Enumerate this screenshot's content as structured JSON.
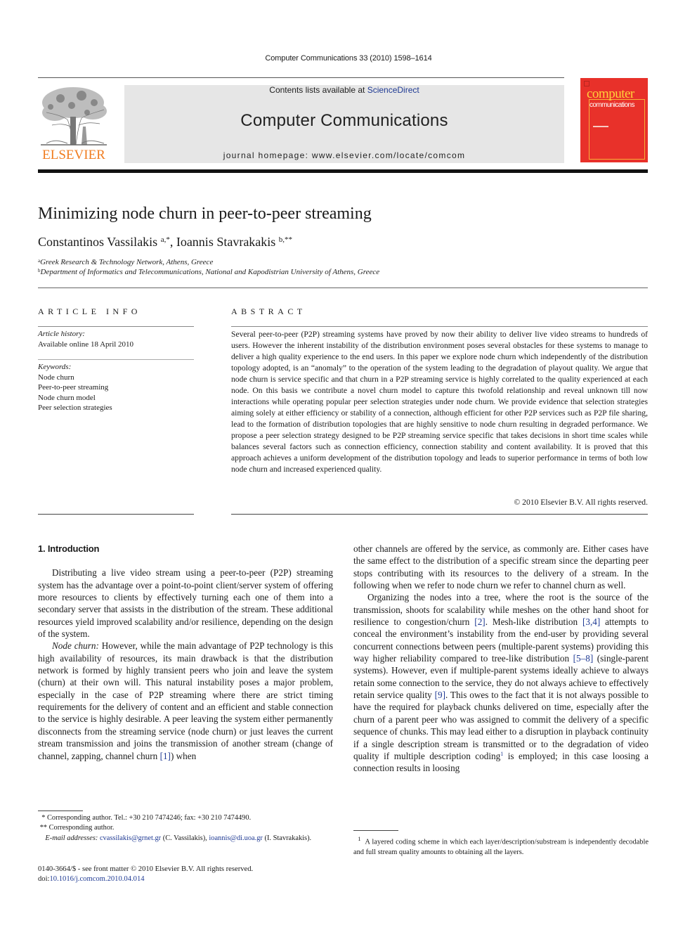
{
  "header": {
    "journal_reference": "Computer Communications 33 (2010) 1598–1614",
    "contents_prefix": "Contents lists available at ",
    "contents_link": "ScienceDirect",
    "journal_name": "Computer Communications",
    "homepage_line": "journal homepage: www.elsevier.com/locate/comcom",
    "publisher_logo_text": "ELSEVIER",
    "cover": {
      "title_line1": "computer",
      "title_line2": "communications",
      "background_color": "#e8312a",
      "title_color": "#ffd23a"
    },
    "logo_color": "#f07c1f"
  },
  "article": {
    "title": "Minimizing node churn in peer-to-peer streaming",
    "authors": [
      {
        "name": "Constantinos Vassilakis",
        "marks": "a,*"
      },
      {
        "name": "Ioannis Stavrakakis",
        "marks": "b,**"
      }
    ],
    "author_separator": ", ",
    "affiliations": [
      {
        "mark": "a",
        "text": "Greek Research & Technology Network, Athens, Greece"
      },
      {
        "mark": "b",
        "text": "Department of Informatics and Telecommunications, National and Kapodistrian University of Athens, Greece"
      }
    ]
  },
  "article_info": {
    "heading": "ARTICLE INFO",
    "history_label": "Article history:",
    "history_value": "Available online 18 April 2010",
    "keywords_label": "Keywords:",
    "keywords": [
      "Node churn",
      "Peer-to-peer streaming",
      "Node churn model",
      "Peer selection strategies"
    ]
  },
  "abstract": {
    "heading": "ABSTRACT",
    "text": "Several peer-to-peer (P2P) streaming systems have proved by now their ability to deliver live video streams to hundreds of users. However the inherent instability of the distribution environment poses several obstacles for these systems to manage to deliver a high quality experience to the end users. In this paper we explore node churn which independently of the distribution topology adopted, is an “anomaly” to the operation of the system leading to the degradation of playout quality. We argue that node churn is service specific and that churn in a P2P streaming service is highly correlated to the quality experienced at each node. On this basis we contribute a novel churn model to capture this twofold relationship and reveal unknown till now interactions while operating popular peer selection strategies under node churn. We provide evidence that selection strategies aiming solely at either efficiency or stability of a connection, although efficient for other P2P services such as P2P file sharing, lead to the formation of distribution topologies that are highly sensitive to node churn resulting in degraded performance. We propose a peer selection strategy designed to be P2P streaming service specific that takes decisions in short time scales while balances several factors such as connection efficiency, connection stability and content availability. It is proved that this approach achieves a uniform development of the distribution topology and leads to superior performance in terms of both low node churn and increased experienced quality.",
    "copyright": "© 2010 Elsevier B.V. All rights reserved."
  },
  "body": {
    "section_heading": "1. Introduction",
    "left_paragraphs": [
      {
        "runs": [
          {
            "t": "Distributing a live video stream using a peer-to-peer (P2P) streaming system has the advantage over a point-to-point client/server system of offering more resources to clients by effectively turning each one of them into a secondary server that assists in the distribution of the stream. These additional resources yield improved scalability and/or resilience, depending on the design of the system."
          }
        ]
      },
      {
        "runs": [
          {
            "t": "Node churn:",
            "style": "em"
          },
          {
            "t": " However, while the main advantage of P2P technology is this high availability of resources, its main drawback is that the distribution network is formed by highly transient peers who join and leave the system (churn) at their own will. This natural instability poses a major problem, especially in the case of P2P streaming where there are strict timing requirements for the delivery of content and an efficient and stable connection to the service is highly desirable. A peer leaving the system either permanently disconnects from the streaming service (node churn) or just leaves the current stream transmission and joins the transmission of another stream (change of channel, zapping, channel churn "
          },
          {
            "t": "[1]",
            "style": "link"
          },
          {
            "t": ") when"
          }
        ]
      }
    ],
    "right_paragraphs": [
      {
        "noindent": true,
        "runs": [
          {
            "t": "other channels are offered by the service, as commonly are. Either cases have the same effect to the distribution of a specific stream since the departing peer stops contributing with its resources to the delivery of a stream. In the following when we refer to node churn we refer to channel churn as well."
          }
        ]
      },
      {
        "runs": [
          {
            "t": "Organizing the nodes into a tree, where the root is the source of the transmission, shoots for scalability while meshes on the other hand shoot for resilience to congestion/churn "
          },
          {
            "t": "[2]",
            "style": "link"
          },
          {
            "t": ". Mesh-like distribution "
          },
          {
            "t": "[3,4]",
            "style": "link"
          },
          {
            "t": " attempts to conceal the environment’s instability from the end-user by providing several concurrent connections between peers (multiple-parent systems) providing this way higher reliability compared to tree-like distribution "
          },
          {
            "t": "[5–8]",
            "style": "link"
          },
          {
            "t": " (single-parent systems). However, even if multiple-parent systems ideally achieve to always retain some connection to the service, they do not always achieve to effectively retain service quality "
          },
          {
            "t": "[9]",
            "style": "link"
          },
          {
            "t": ". This owes to the fact that it is not always possible to have the required for playback chunks delivered on time, especially after the churn of a parent peer who was assigned to commit the delivery of a specific sequence of chunks. This may lead either to a disruption in playback continuity if a single description stream is transmitted or to the degradation of video quality if multiple description coding"
          },
          {
            "t": "1",
            "style": "sup-link"
          },
          {
            "t": " is employed; in this case loosing a connection results in loosing"
          }
        ]
      }
    ]
  },
  "footnotes": {
    "left": [
      {
        "runs": [
          {
            "t": "  * Corresponding author. Tel.: +30 210 7474246; fax: +30 210 7474490."
          }
        ]
      },
      {
        "runs": [
          {
            "t": " ** Corresponding author."
          }
        ]
      },
      {
        "runs": [
          {
            "t": "    E-mail addresses:",
            "style": "em"
          },
          {
            "t": " "
          },
          {
            "t": "cvassilakis@grnet.gr",
            "style": "link"
          },
          {
            "t": " (C. Vassilakis), "
          },
          {
            "t": "ioannis@di.uoa.gr",
            "style": "link"
          },
          {
            "t": " (I. Stavrakakis)."
          }
        ]
      }
    ],
    "right": [
      {
        "runs": [
          {
            "t": "  "
          },
          {
            "t": "1",
            "style": "sup"
          },
          {
            "t": "  A layered coding scheme in which each layer/description/substream is independently decodable and full stream quality amounts to obtaining all the layers."
          }
        ]
      }
    ],
    "front_matter": "0140-3664/$ - see front matter © 2010 Elsevier B.V. All rights reserved.",
    "doi_prefix": "doi:",
    "doi": "10.1016/j.comcom.2010.04.014"
  },
  "colors": {
    "link": "#1f3a93",
    "text": "#1a1a1a",
    "masthead_bg": "#e6e6e6"
  }
}
